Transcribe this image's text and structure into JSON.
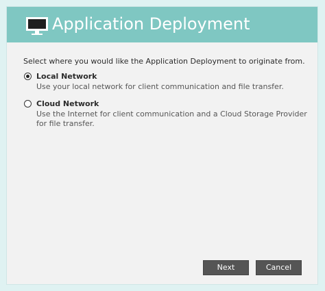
{
  "header": {
    "title": "Application Deployment",
    "icon": "monitor-icon",
    "color": "#7fc7c2"
  },
  "prompt": "Select where you would like the Application Deployment to originate from.",
  "options": [
    {
      "label": "Local Network",
      "description": "Use your local network for client communication and file transfer.",
      "selected": true
    },
    {
      "label": "Cloud Network",
      "description": "Use the Internet for client communication and a Cloud Storage Provider for file transfer.",
      "selected": false
    }
  ],
  "buttons": {
    "next_label": "Next",
    "cancel_label": "Cancel"
  }
}
